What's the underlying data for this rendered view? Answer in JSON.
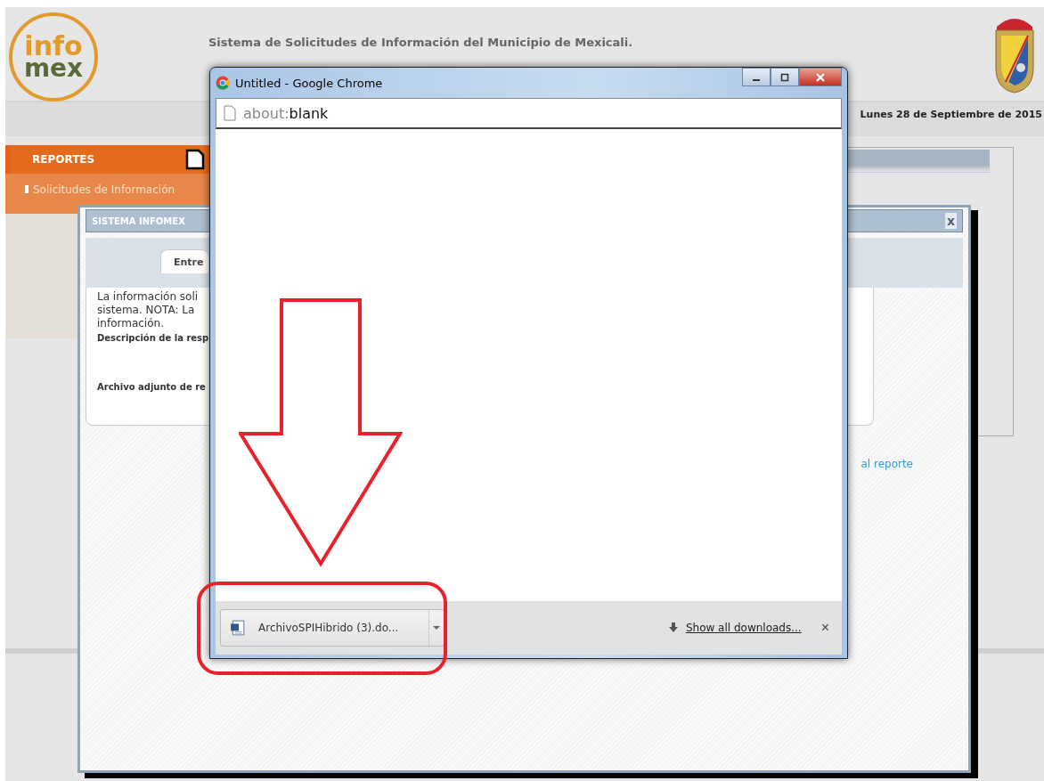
{
  "header": {
    "logo": {
      "top": "info",
      "bottom": "mex"
    },
    "title": "Sistema de Solicitudes de Información del Municipio de Mexicali.",
    "date": "Lunes 28 de Septiembre de 2015"
  },
  "sidebar": {
    "heading": "REPORTES",
    "items": [
      {
        "label": "Solicitudes de Información"
      }
    ]
  },
  "modal": {
    "title": "SISTEMA INFOMEX",
    "close_label": "x",
    "tabs": [
      {
        "label": "Entre",
        "selected": true
      }
    ],
    "lines": [
      "La información soli",
      "sistema. NOTA: La",
      "información."
    ],
    "fields": [
      "Descripción de la resp",
      "Archivo adjunto de re"
    ],
    "link": "al reporte"
  },
  "browser": {
    "title": "Untitled - Google Chrome",
    "address_scheme": "about:",
    "address_rest": "blank",
    "downloads": [
      {
        "filename": "ArchivoSPIHibrido (3).do..."
      }
    ],
    "show_all": "Show all downloads...",
    "close_glyph": "×"
  }
}
